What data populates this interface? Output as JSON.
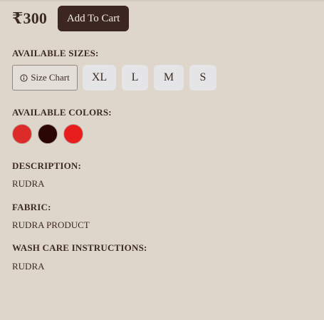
{
  "product": {
    "price": "₹300",
    "add_to_cart_label": "Add To Cart"
  },
  "sizes": {
    "heading": "AVAILABLE SIZES:",
    "size_chart_label": "Size Chart",
    "options": [
      "XL",
      "L",
      "M",
      "S"
    ]
  },
  "colors": {
    "heading": "AVAILABLE COLORS:",
    "swatches": [
      "#dd2b2a",
      "#2a0705",
      "#e81d1e"
    ]
  },
  "description": {
    "heading": "DESCRIPTION:",
    "value": "RUDRA"
  },
  "fabric": {
    "heading": "FABRIC:",
    "value": "RUDRA PRODUCT"
  },
  "wash_care": {
    "heading": "WASH CARE INSTRUCTIONS:",
    "value": "RUDRA"
  },
  "icons": {
    "size_chart_icon": "info-circle-icon"
  }
}
